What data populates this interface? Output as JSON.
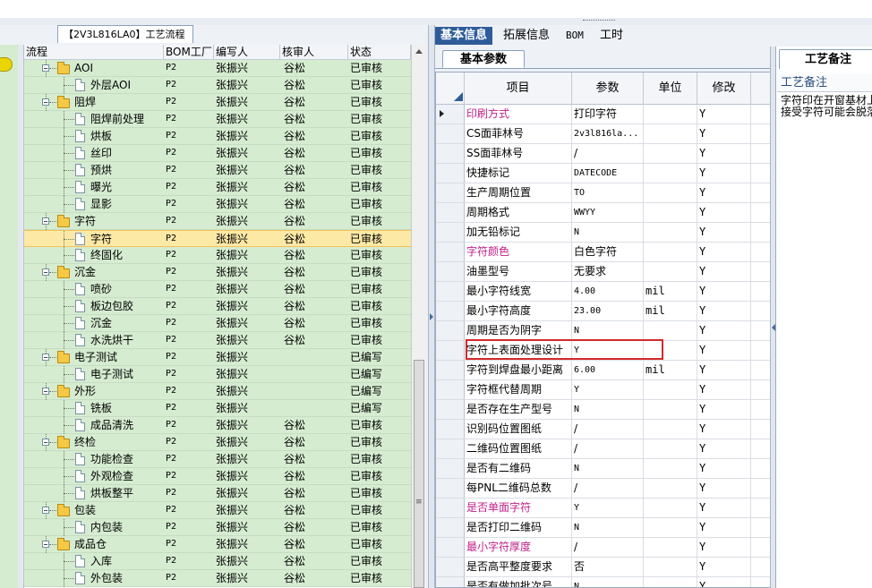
{
  "left": {
    "title": "【2V3L816LA0】工艺流程",
    "columns": [
      "流程",
      "BOM工厂",
      "编写人",
      "核审人",
      "状态"
    ],
    "rows": [
      {
        "name": "AOI",
        "level": 0,
        "type": "folder",
        "bom": "P2",
        "writer": "张振兴",
        "reviewer": "谷松",
        "status": "已审核"
      },
      {
        "name": "外层AOI",
        "level": 1,
        "type": "doc",
        "bom": "P2",
        "writer": "张振兴",
        "reviewer": "谷松",
        "status": "已审核"
      },
      {
        "name": "阻焊",
        "level": 0,
        "type": "folder",
        "bom": "P2",
        "writer": "张振兴",
        "reviewer": "谷松",
        "status": "已审核"
      },
      {
        "name": "阻焊前处理",
        "level": 1,
        "type": "doc",
        "bom": "P2",
        "writer": "张振兴",
        "reviewer": "谷松",
        "status": "已审核"
      },
      {
        "name": "烘板",
        "level": 1,
        "type": "doc",
        "bom": "P2",
        "writer": "张振兴",
        "reviewer": "谷松",
        "status": "已审核"
      },
      {
        "name": "丝印",
        "level": 1,
        "type": "doc",
        "bom": "P2",
        "writer": "张振兴",
        "reviewer": "谷松",
        "status": "已审核"
      },
      {
        "name": "预烘",
        "level": 1,
        "type": "doc",
        "bom": "P2",
        "writer": "张振兴",
        "reviewer": "谷松",
        "status": "已审核"
      },
      {
        "name": "曝光",
        "level": 1,
        "type": "doc",
        "bom": "P2",
        "writer": "张振兴",
        "reviewer": "谷松",
        "status": "已审核"
      },
      {
        "name": "显影",
        "level": 1,
        "type": "doc",
        "bom": "P2",
        "writer": "张振兴",
        "reviewer": "谷松",
        "status": "已审核"
      },
      {
        "name": "字符",
        "level": 0,
        "type": "folder",
        "bom": "P2",
        "writer": "张振兴",
        "reviewer": "谷松",
        "status": "已审核"
      },
      {
        "name": "字符",
        "level": 1,
        "type": "doc",
        "bom": "P2",
        "writer": "张振兴",
        "reviewer": "谷松",
        "status": "已审核",
        "selected": true
      },
      {
        "name": "终固化",
        "level": 1,
        "type": "doc",
        "bom": "P2",
        "writer": "张振兴",
        "reviewer": "谷松",
        "status": "已审核"
      },
      {
        "name": "沉金",
        "level": 0,
        "type": "folder",
        "bom": "P2",
        "writer": "张振兴",
        "reviewer": "谷松",
        "status": "已审核"
      },
      {
        "name": "喷砂",
        "level": 1,
        "type": "doc",
        "bom": "P2",
        "writer": "张振兴",
        "reviewer": "谷松",
        "status": "已审核"
      },
      {
        "name": "板边包胶",
        "level": 1,
        "type": "doc",
        "bom": "P2",
        "writer": "张振兴",
        "reviewer": "谷松",
        "status": "已审核"
      },
      {
        "name": "沉金",
        "level": 1,
        "type": "doc",
        "bom": "P2",
        "writer": "张振兴",
        "reviewer": "谷松",
        "status": "已审核"
      },
      {
        "name": "水洗烘干",
        "level": 1,
        "type": "doc",
        "bom": "P2",
        "writer": "张振兴",
        "reviewer": "谷松",
        "status": "已审核"
      },
      {
        "name": "电子测试",
        "level": 0,
        "type": "folder",
        "bom": "P2",
        "writer": "张振兴",
        "reviewer": "",
        "status": "已编写"
      },
      {
        "name": "电子测试",
        "level": 1,
        "type": "doc",
        "bom": "P2",
        "writer": "张振兴",
        "reviewer": "",
        "status": "已编写"
      },
      {
        "name": "外形",
        "level": 0,
        "type": "folder",
        "bom": "P2",
        "writer": "张振兴",
        "reviewer": "",
        "status": "已编写"
      },
      {
        "name": "铣板",
        "level": 1,
        "type": "doc",
        "bom": "P2",
        "writer": "张振兴",
        "reviewer": "",
        "status": "已编写"
      },
      {
        "name": "成品清洗",
        "level": 1,
        "type": "doc",
        "bom": "P2",
        "writer": "张振兴",
        "reviewer": "谷松",
        "status": "已审核"
      },
      {
        "name": "终检",
        "level": 0,
        "type": "folder",
        "bom": "P2",
        "writer": "张振兴",
        "reviewer": "谷松",
        "status": "已审核"
      },
      {
        "name": "功能检查",
        "level": 1,
        "type": "doc",
        "bom": "P2",
        "writer": "张振兴",
        "reviewer": "谷松",
        "status": "已审核"
      },
      {
        "name": "外观检查",
        "level": 1,
        "type": "doc",
        "bom": "P2",
        "writer": "张振兴",
        "reviewer": "谷松",
        "status": "已审核"
      },
      {
        "name": "烘板整平",
        "level": 1,
        "type": "doc",
        "bom": "P2",
        "writer": "张振兴",
        "reviewer": "谷松",
        "status": "已审核"
      },
      {
        "name": "包装",
        "level": 0,
        "type": "folder",
        "bom": "P2",
        "writer": "张振兴",
        "reviewer": "谷松",
        "status": "已审核"
      },
      {
        "name": "内包装",
        "level": 1,
        "type": "doc",
        "bom": "P2",
        "writer": "张振兴",
        "reviewer": "谷松",
        "status": "已审核"
      },
      {
        "name": "成品仓",
        "level": 0,
        "type": "folder",
        "bom": "P2",
        "writer": "张振兴",
        "reviewer": "谷松",
        "status": "已审核"
      },
      {
        "name": "入库",
        "level": 1,
        "type": "doc",
        "bom": "P2",
        "writer": "张振兴",
        "reviewer": "谷松",
        "status": "已审核"
      },
      {
        "name": "外包装",
        "level": 1,
        "type": "doc",
        "bom": "P2",
        "writer": "张振兴",
        "reviewer": "谷松",
        "status": "已审核"
      }
    ]
  },
  "right": {
    "tabs": [
      "基本信息",
      "拓展信息",
      "BOM",
      "工时"
    ],
    "active_tab": "基本信息",
    "subtab": "基本参数",
    "columns": [
      "项目",
      "参数",
      "单位",
      "修改"
    ],
    "rows": [
      {
        "item": "印刷方式",
        "param": "打印字符",
        "unit": "",
        "modify": "Y",
        "pink": true,
        "current": true
      },
      {
        "item": "CS面菲林号",
        "param": "2v3l816la...",
        "unit": "",
        "modify": "Y",
        "mono": true
      },
      {
        "item": "SS面菲林号",
        "param": "/",
        "unit": "",
        "modify": "Y"
      },
      {
        "item": "快捷标记",
        "param": "DATECODE",
        "unit": "",
        "modify": "Y",
        "mono": true
      },
      {
        "item": "生产周期位置",
        "param": "TO",
        "unit": "",
        "modify": "Y",
        "mono": true
      },
      {
        "item": "周期格式",
        "param": "WWYY",
        "unit": "",
        "modify": "Y",
        "mono": true
      },
      {
        "item": "加无铅标记",
        "param": "N",
        "unit": "",
        "modify": "Y",
        "mono": true
      },
      {
        "item": "字符颜色",
        "param": "白色字符",
        "unit": "",
        "modify": "Y",
        "pink": true
      },
      {
        "item": "油墨型号",
        "param": "无要求",
        "unit": "",
        "modify": "Y"
      },
      {
        "item": "最小字符线宽",
        "param": "4.00",
        "unit": "mil",
        "modify": "Y",
        "mono": true
      },
      {
        "item": "最小字符高度",
        "param": "23.00",
        "unit": "mil",
        "modify": "Y",
        "mono": true
      },
      {
        "item": "周期是否为阴字",
        "param": "N",
        "unit": "",
        "modify": "Y",
        "mono": true
      },
      {
        "item": "字符上表面处理设计",
        "param": "Y",
        "unit": "",
        "modify": "Y",
        "mono": true
      },
      {
        "item": "字符到焊盘最小距离",
        "param": "6.00",
        "unit": "mil",
        "modify": "Y",
        "mono": true
      },
      {
        "item": "字符框代替周期",
        "param": "Y",
        "unit": "",
        "modify": "Y",
        "mono": true
      },
      {
        "item": "是否存在生产型号",
        "param": "N",
        "unit": "",
        "modify": "Y",
        "mono": true
      },
      {
        "item": "识别码位置图纸",
        "param": "/",
        "unit": "",
        "modify": "Y"
      },
      {
        "item": "二维码位置图纸",
        "param": "/",
        "unit": "",
        "modify": "Y"
      },
      {
        "item": "是否有二维码",
        "param": "N",
        "unit": "",
        "modify": "Y",
        "mono": true
      },
      {
        "item": "每PNL二维码总数",
        "param": "/",
        "unit": "",
        "modify": "Y"
      },
      {
        "item": "是否单面字符",
        "param": "Y",
        "unit": "",
        "modify": "Y",
        "pink": true,
        "mono": true
      },
      {
        "item": "是否打印二维码",
        "param": "N",
        "unit": "",
        "modify": "Y",
        "mono": true
      },
      {
        "item": "最小字符厚度",
        "param": "/",
        "unit": "",
        "modify": "Y",
        "pink": true
      },
      {
        "item": "是否高平整度要求",
        "param": "否",
        "unit": "",
        "modify": "Y"
      },
      {
        "item": "是否有做加批次号",
        "param": "N",
        "unit": "",
        "modify": "Y",
        "mono": true
      }
    ]
  },
  "notes": {
    "tab": "工艺备注",
    "label": "工艺备注",
    "text_lines": [
      "字符印在开窗基材上",
      "接受字符可能会脱落"
    ]
  }
}
